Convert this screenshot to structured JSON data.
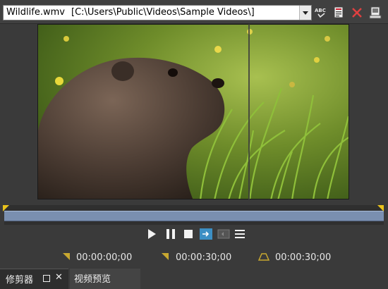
{
  "toolbar": {
    "file_name": "Wildlife.wmv",
    "file_path": "[C:\\Users\\Public\\Videos\\Sample Videos\\]",
    "spell_icon_text": "ABC"
  },
  "timecodes": {
    "current": "00:00:00;00",
    "out_point": "00:00:30;00",
    "duration": "00:00:30;00"
  },
  "tabs": {
    "trimmer": "修剪器",
    "video_preview": "视频预览",
    "close_symbol": "✕"
  },
  "colors": {
    "marker": "#e9c21b",
    "track": "#7a8fb0",
    "active_toggle": "#3c8fc4"
  }
}
